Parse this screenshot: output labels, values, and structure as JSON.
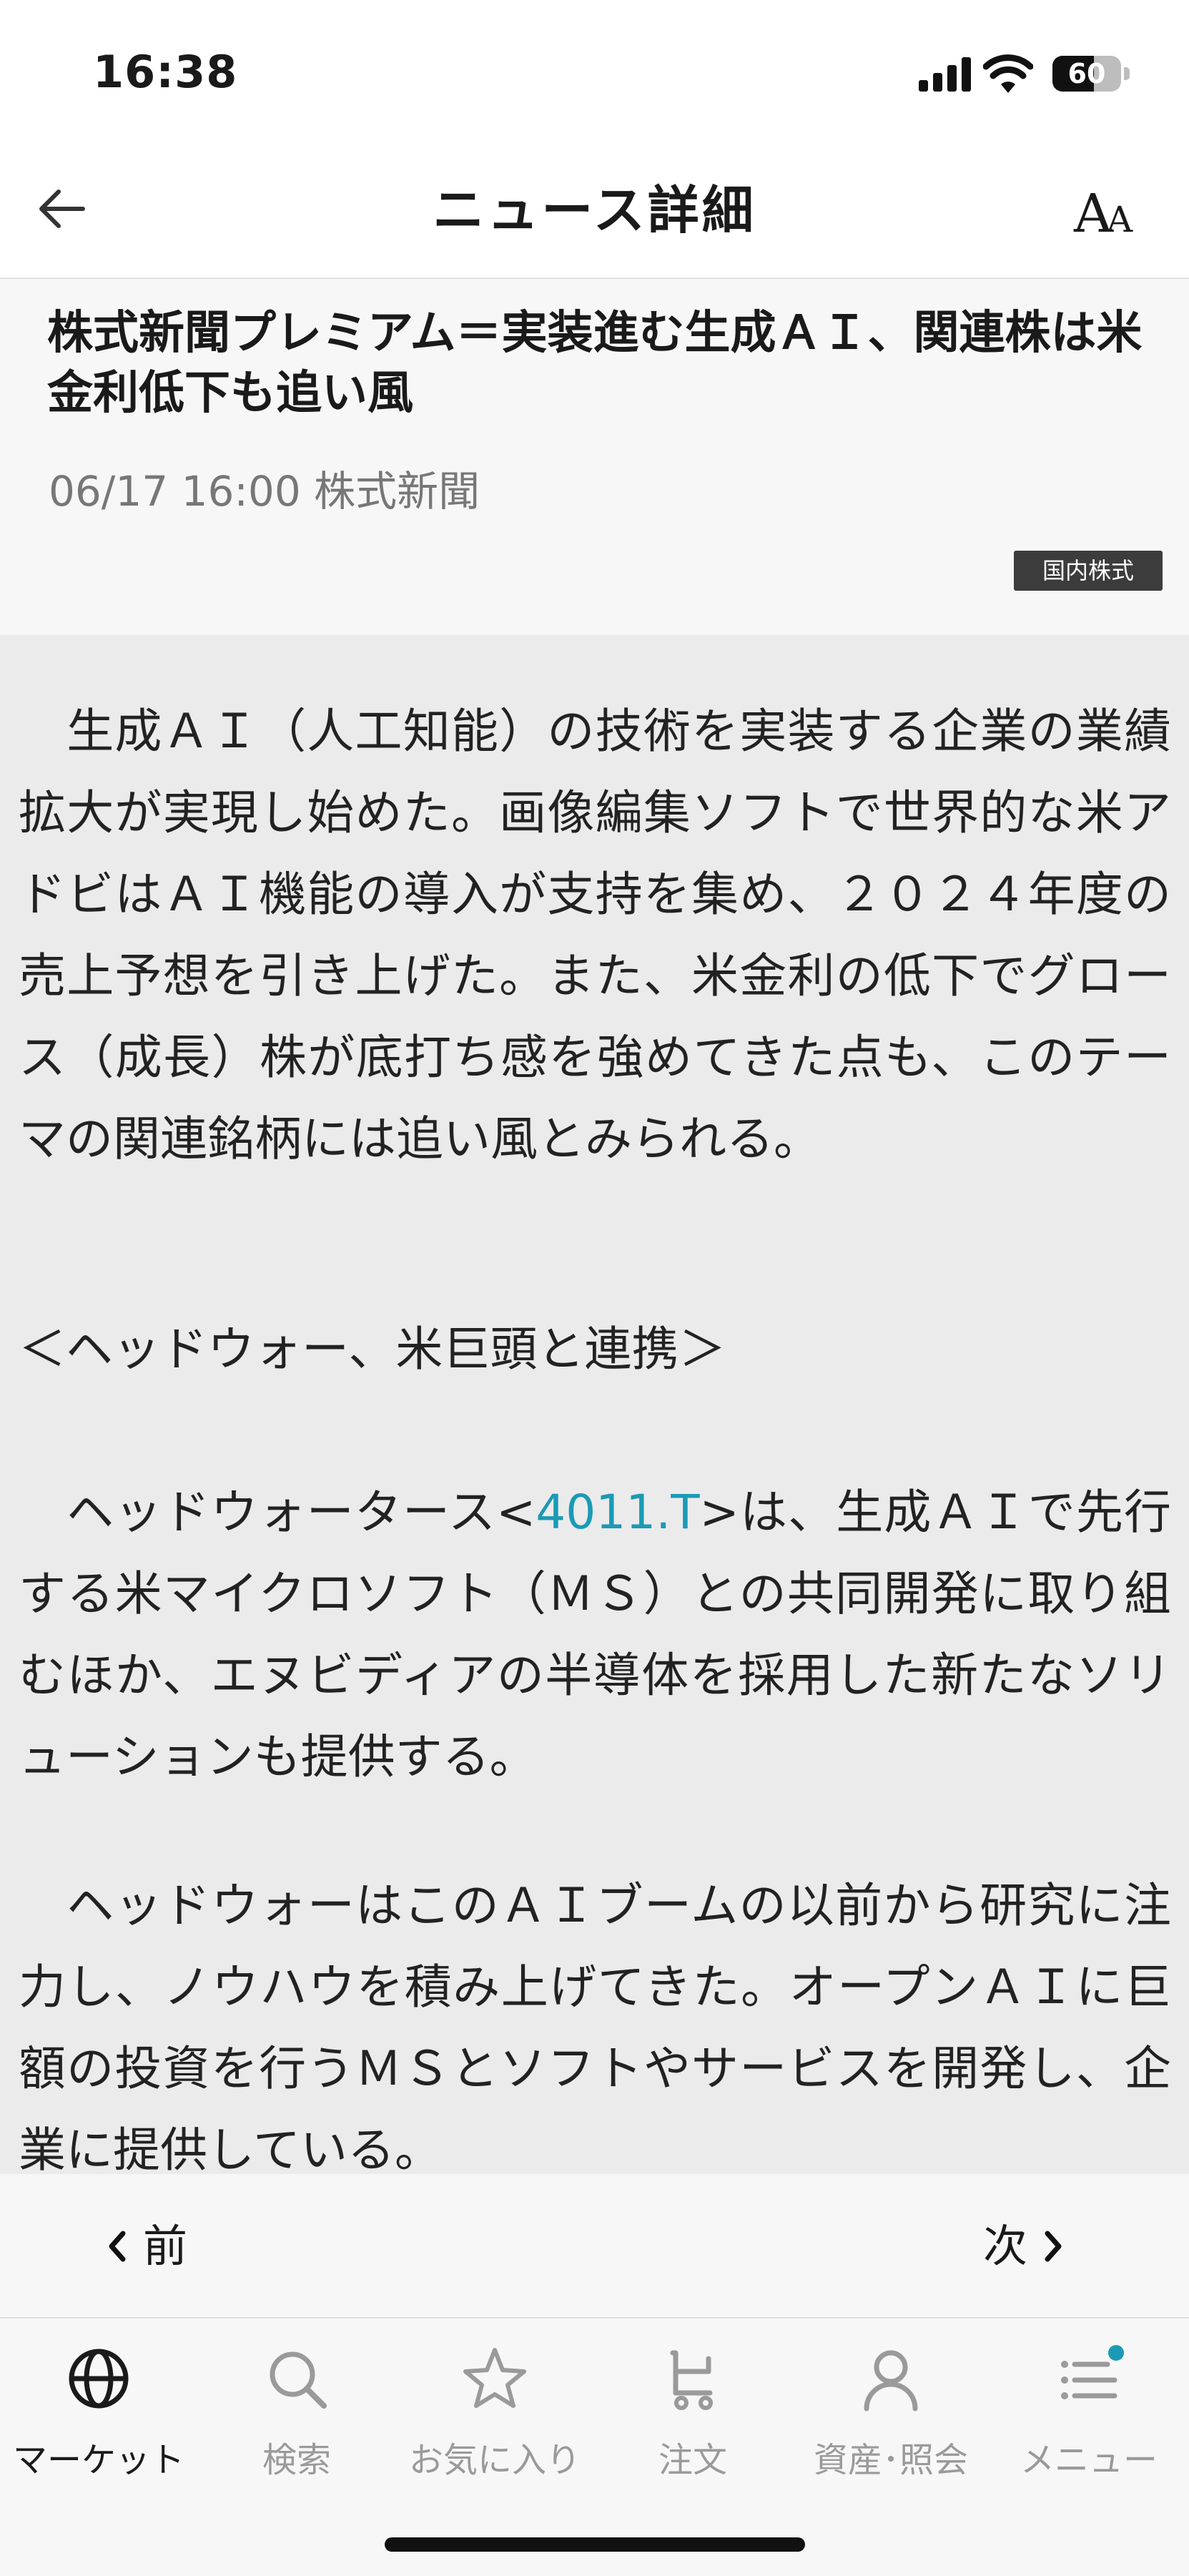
{
  "status_bar": {
    "time": "16:38",
    "battery_level": "60",
    "battery_fraction": 0.6
  },
  "header": {
    "title": "ニュース詳細",
    "back_icon": "arrow-left-icon",
    "font_size_label_big": "A",
    "font_size_label_small": "A"
  },
  "article": {
    "headline": "株式新聞プレミアム＝実装進む生成ＡＩ、関連株は米金利低下も追い風",
    "datetime": "06/17 16:00",
    "source": "株式新聞",
    "category": "国内株式",
    "p1": "　生成ＡＩ（人工知能）の技術を実装する企業の業績拡大が実現し始めた。画像編集ソフトで世界的な米アドビはＡＩ機能の導入が支持を集め、２０２４年度の売上予想を引き上げた。また、米金利の低下でグロース（成長）株が底打ち感を強めてきた点も、このテーマの関連銘柄には追い風とみられる。",
    "p2": "＜ヘッドウォー、米巨頭と連携＞",
    "p3_before": "　ヘッドウォータース<",
    "p3_ticker": "4011.T",
    "p3_after": ">は、生成ＡＩで先行する米マイクロソフト（ＭＳ）との共同開発に取り組むほか、エヌビディアの半導体を採用した新たなソリューションも提供する。",
    "p4": "　ヘッドウォーはこのＡＩブームの以前から研究に注力し、ノウハウを積み上げてきた。オープンＡＩに巨額の投資を行うＭＳとソフトやサービスを開発し、企業に提供している。"
  },
  "pager": {
    "prev_label": "前",
    "next_label": "次"
  },
  "tabs": [
    {
      "label": "マーケット",
      "icon": "globe-icon"
    },
    {
      "label": "検索",
      "icon": "search-icon"
    },
    {
      "label": "お気に入り",
      "icon": "star-icon"
    },
    {
      "label": "注文",
      "icon": "cart-icon"
    },
    {
      "label": "資産･照会",
      "icon": "person-icon"
    },
    {
      "label": "メニュー",
      "icon": "menu-icon"
    }
  ],
  "colors": {
    "link": "#1b9ab5",
    "badge_dot": "#1b9ab5",
    "active_tab": "#1a1a1a",
    "inactive_tab": "#9a9a9a"
  }
}
